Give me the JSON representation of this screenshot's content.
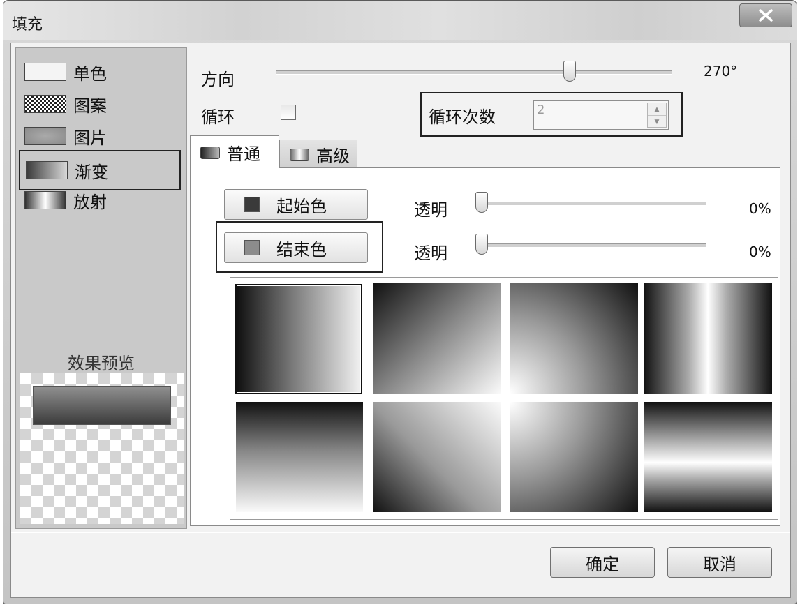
{
  "window": {
    "title": "填充",
    "close_label": "X"
  },
  "fill_types": [
    {
      "label": "单色",
      "icon": "solid-swatch-icon"
    },
    {
      "label": "图案",
      "icon": "pattern-swatch-icon"
    },
    {
      "label": "图片",
      "icon": "picture-swatch-icon"
    },
    {
      "label": "渐变",
      "icon": "gradient-swatch-icon",
      "selected": true
    },
    {
      "label": "放射",
      "icon": "radial-swatch-icon"
    }
  ],
  "preview": {
    "label": "效果预览"
  },
  "direction": {
    "label": "方向",
    "value": "270°",
    "level": 0.75
  },
  "loop": {
    "label": "循环",
    "checked": false,
    "count_label": "循环次数",
    "count_value": "2"
  },
  "tabs": [
    {
      "label": "普通",
      "active": true
    },
    {
      "label": "高级",
      "active": false
    }
  ],
  "start_color": {
    "label": "起始色",
    "color": "#3a3a3a",
    "transparency_label": "透明",
    "transparency_value": "0%",
    "level": 0
  },
  "end_color": {
    "label": "结束色",
    "color": "#8c8c8c",
    "transparency_label": "透明",
    "transparency_value": "0%",
    "level": 0
  },
  "presets": [
    {
      "name": "horizontal",
      "selected": true
    },
    {
      "name": "diagonal-down"
    },
    {
      "name": "corner-radial"
    },
    {
      "name": "vertical-bands"
    },
    {
      "name": "vertical"
    },
    {
      "name": "diagonal-up"
    },
    {
      "name": "corner-radial-alt"
    },
    {
      "name": "horizontal-bands"
    }
  ],
  "buttons": {
    "ok": "确定",
    "cancel": "取消"
  }
}
